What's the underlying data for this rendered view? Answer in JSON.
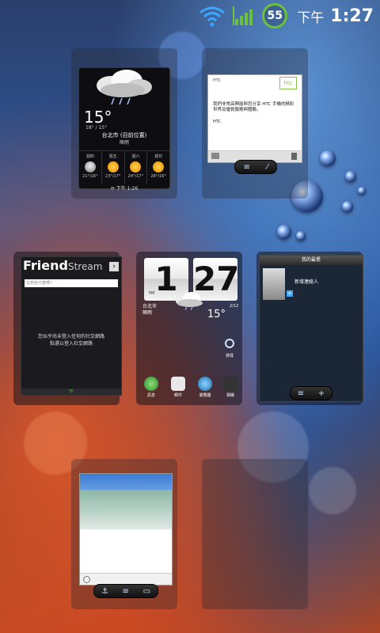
{
  "status_bar": {
    "battery": "55",
    "ampm": "下午",
    "time": "1:27"
  },
  "weather_widget": {
    "temperature": "15°",
    "range": "18° / 15°",
    "location": "台北市 (目前位置)",
    "condition": "陣雨",
    "forecast": [
      {
        "day": "週四",
        "range": "21°/16°",
        "icon": "rain-cloud-icon"
      },
      {
        "day": "週五",
        "range": "23°/17°",
        "icon": "sun-cloud-icon"
      },
      {
        "day": "週六",
        "range": "24°/17°",
        "icon": "sun-icon"
      },
      {
        "day": "週日",
        "range": "28°/16°",
        "icon": "sun-icon"
      }
    ],
    "updated": "下午 1:26"
  },
  "htc_note": {
    "logo": "htc",
    "header": "HTC",
    "body": "我們非常高興能與您分享 HTC 手機的精彩世界及優質服務與體驗。",
    "signature": "HTC"
  },
  "friend_stream": {
    "title_bold": "Friend",
    "title_light": "Stream",
    "placeholder": "在想些什麼嗎？",
    "message_line1": "您似乎尚未登入任何的社交網路",
    "message_line2": "點選以登入社交網路"
  },
  "clock_widget": {
    "hour": "1",
    "minute": "27",
    "ampm": "PM",
    "city": "台北市",
    "condition": "陣雨",
    "temperature": "15°",
    "date": "2/12",
    "search_label": "搜尋",
    "apps": [
      {
        "label": "訊息",
        "name": "messages-app"
      },
      {
        "label": "郵件",
        "name": "mail-app"
      },
      {
        "label": "瀏覽器",
        "name": "browser-app"
      },
      {
        "label": "相機",
        "name": "camera-app"
      }
    ]
  },
  "contacts_widget": {
    "title": "我的最愛",
    "add_label": "新增連絡人"
  },
  "colors": {
    "accent_green": "#6cc13a",
    "htc_green": "#8bc34a"
  }
}
